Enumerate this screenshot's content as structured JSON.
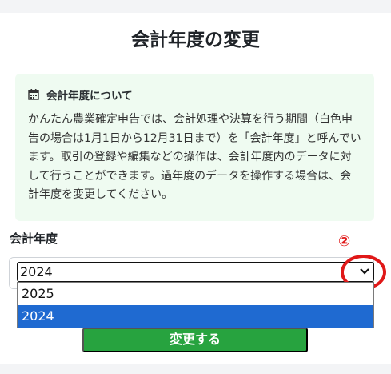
{
  "page": {
    "title": "会計年度の変更"
  },
  "info": {
    "icon": "calendar-icon",
    "title": "会計年度について",
    "body": "かんたん農業確定申告では、会計処理や決算を行う期間（白色申告の場合は1月1日から12月31日まで）を「会計年度」と呼んでいます。取引の登録や編集などの操作は、会計年度内のデータに対して行うことができます。過年度のデータを操作する場合は、会計年度を変更してください。"
  },
  "form": {
    "label": "会計年度",
    "selected_value": "2024",
    "options": [
      "2025",
      "2024"
    ],
    "submit_label": "変更する"
  },
  "annotation": {
    "number": "②",
    "color": "#e01818"
  },
  "colors": {
    "accent_green": "#27a33f",
    "info_bg": "#effbf1",
    "selection_blue": "#1f6ad1"
  }
}
